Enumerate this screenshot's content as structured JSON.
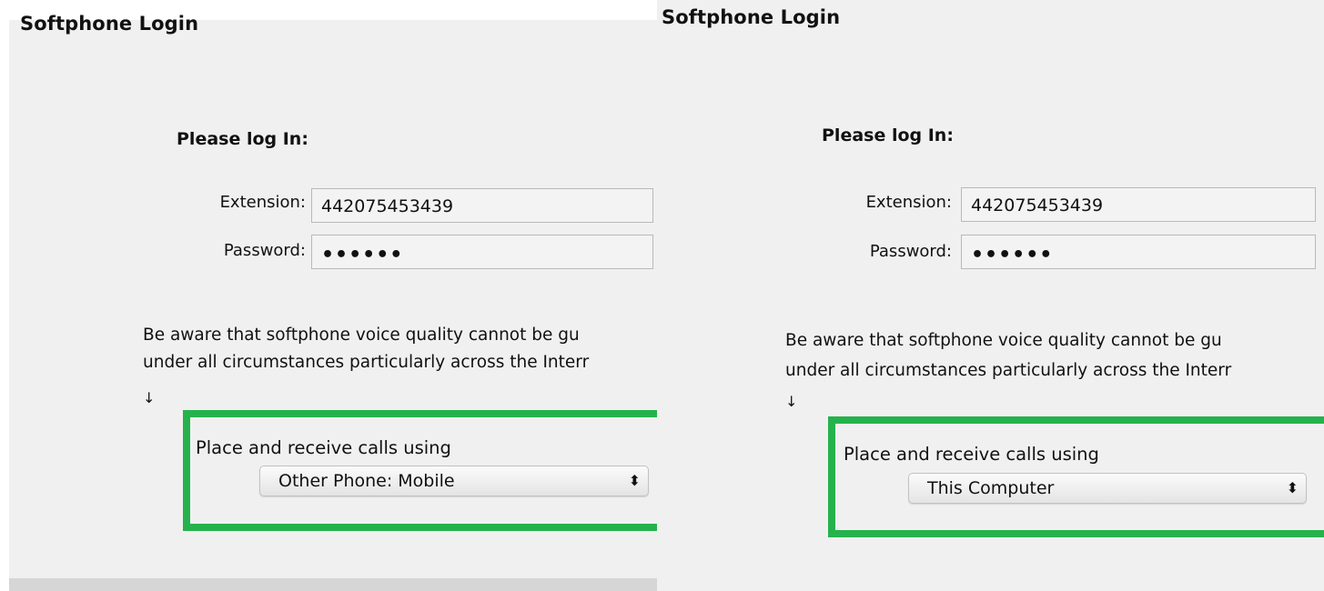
{
  "panels": [
    {
      "title": "Softphone Login",
      "heading": "Please log In:",
      "extension_label": "Extension:",
      "extension_value": "442075453439",
      "password_label": "Password:",
      "password_value": "••••••",
      "notice_line1": "Be aware that softphone voice quality cannot be gu",
      "notice_line2": "under all circumstances particularly across the Interr",
      "arrow": "↓",
      "calls_label": "Place and receive calls using",
      "calls_value": "Other Phone: Mobile",
      "caret": "⬍"
    },
    {
      "title": "Softphone Login",
      "heading": "Please log In:",
      "extension_label": "Extension:",
      "extension_value": "442075453439",
      "password_label": "Password:",
      "password_value": "••••••",
      "notice_line1": "Be aware that softphone voice quality cannot be gu",
      "notice_line2": "under all circumstances particularly across the Interr",
      "arrow": "↓",
      "calls_label": "Place and receive calls using",
      "calls_value": "This Computer",
      "caret": "⬍"
    }
  ],
  "colors": {
    "highlight": "#25b24d",
    "panel_bg": "#f0f0f0"
  }
}
